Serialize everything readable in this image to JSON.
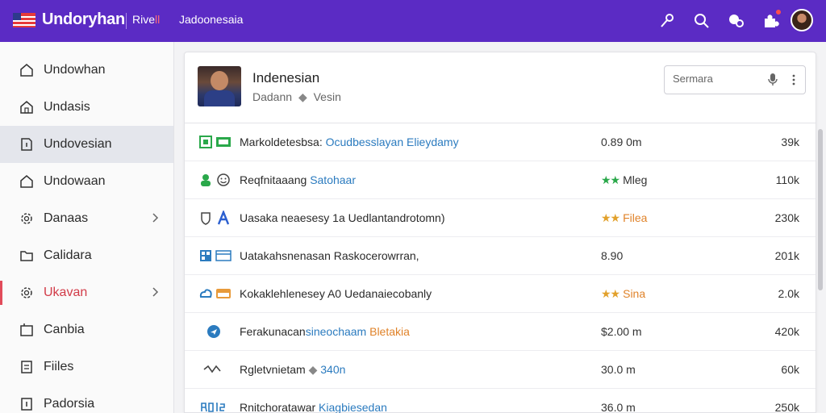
{
  "topbar": {
    "brand": "Undoryhan",
    "nav_a_prefix": "Rive",
    "nav_a_accent": "ll",
    "nav_b": "Jadoonesaia",
    "accent_color": "#5b2bc4"
  },
  "sidebar": {
    "items": [
      {
        "label": "Undowhan",
        "icon": "home-icon"
      },
      {
        "label": "Undasis",
        "icon": "house-icon"
      },
      {
        "label": "Undovesian",
        "icon": "page-icon"
      },
      {
        "label": "Undowaan",
        "icon": "home-icon"
      },
      {
        "label": "Danaas",
        "icon": "gear-icon"
      },
      {
        "label": "Calidara",
        "icon": "folder-icon"
      },
      {
        "label": "Ukavan",
        "icon": "gear-icon"
      },
      {
        "label": "Canbia",
        "icon": "archive-icon"
      },
      {
        "label": "Fiiles",
        "icon": "list-icon"
      },
      {
        "label": "Padorsia",
        "icon": "page-icon"
      }
    ]
  },
  "card": {
    "title": "Indenesian",
    "subtitle_a": "Dadann",
    "subtitle_b": "Vesin",
    "search_placeholder": "Sermara"
  },
  "rows": [
    {
      "name": "Markoldetesbsa:",
      "link": "Ocudbesslayan Elieydamy",
      "link_color": "blue",
      "mid": "0.89 0m",
      "stars": "",
      "val": "39k"
    },
    {
      "name": "Reqfnitaaang",
      "link": "Satohaar",
      "link_color": "blue",
      "mid": "Mleg",
      "stars": "★★",
      "stars_color": "#2aa84a",
      "val": "110k"
    },
    {
      "name": "Uasaka neaesesy 1a Uedlantandrotomn)",
      "link": "",
      "link_color": "",
      "mid": "Filea",
      "stars": "★★",
      "stars_color": "#e2a12c",
      "val": "230k"
    },
    {
      "name": "Uatakahsnenasan Raskocerowrran,",
      "link": "",
      "link_color": "",
      "mid": "8.90",
      "stars": "",
      "val": "201k"
    },
    {
      "name": "Kokaklehlenesey A0 Uedanaiecobanly",
      "link": "",
      "link_color": "",
      "mid": "Sina",
      "stars": "★★",
      "stars_color": "#e2a12c",
      "val": "2.0k"
    },
    {
      "name": "Ferakunacan",
      "link": "sineochaam",
      "link_color": "blue",
      "link2": "Bletakia",
      "mid": "$2.00 m",
      "stars": "",
      "val": "420k"
    },
    {
      "name": "Rgletvnietam",
      "link": "340n",
      "link_color": "blue",
      "mid": "30.0 m",
      "stars": "",
      "val": "60k"
    },
    {
      "name": "Rnitchoratawar",
      "link": "Kiagbiesedan",
      "link_color": "blue",
      "mid": "36.0 m",
      "stars": "",
      "val": "250k"
    }
  ]
}
